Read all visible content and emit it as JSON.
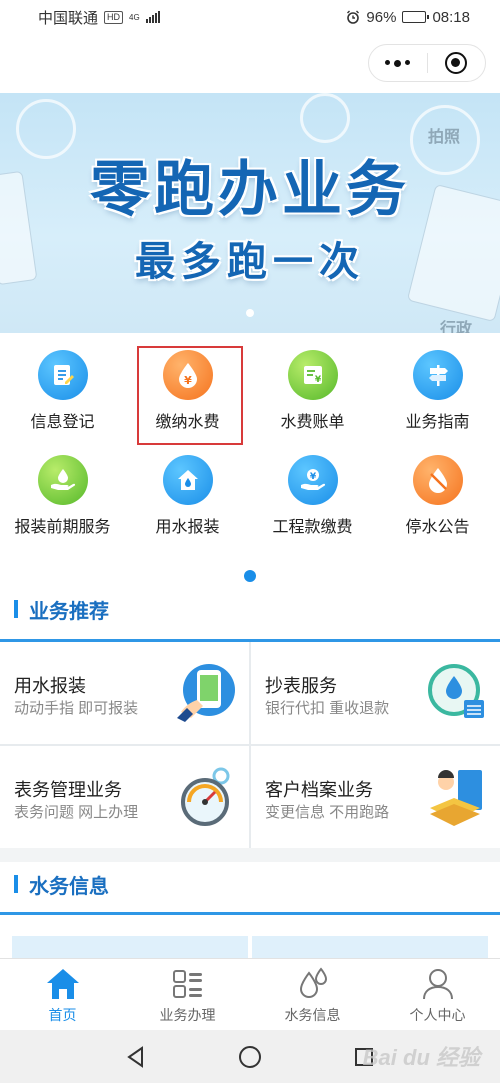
{
  "status_bar": {
    "carrier": "中国联通",
    "hd": "HD",
    "network": "4G",
    "battery_percent": "96%",
    "battery_level": 0.96,
    "time": "08:18"
  },
  "banner": {
    "line1": "零跑办业务",
    "line2": "最多跑一次",
    "bg_tag_1": "拍照",
    "bg_tag_2": "行政"
  },
  "services": [
    {
      "label": "信息登记",
      "icon": "edit-doc-icon",
      "color": "blue"
    },
    {
      "label": "缴纳水费",
      "icon": "yuan-drop-icon",
      "color": "orange",
      "highlighted": true
    },
    {
      "label": "水费账单",
      "icon": "bill-icon",
      "color": "green"
    },
    {
      "label": "业务指南",
      "icon": "signpost-icon",
      "color": "blue"
    },
    {
      "label": "报装前期服务",
      "icon": "hand-drop-icon",
      "color": "green"
    },
    {
      "label": "用水报装",
      "icon": "house-drop-icon",
      "color": "blue"
    },
    {
      "label": "工程款缴费",
      "icon": "hand-yuan-icon",
      "color": "blue"
    },
    {
      "label": "停水公告",
      "icon": "no-water-icon",
      "color": "orange"
    }
  ],
  "recommend": {
    "title": "业务推荐",
    "items": [
      {
        "name": "用水报装",
        "desc": "动动手指 即可报装",
        "icon": "phone-tap-icon"
      },
      {
        "name": "抄表服务",
        "desc": "银行代扣 重收退款",
        "icon": "clock-drop-icon"
      },
      {
        "name": "表务管理业务",
        "desc": "表务问题 网上办理",
        "icon": "gauge-icon"
      },
      {
        "name": "客户档案业务",
        "desc": "变更信息 不用跑路",
        "icon": "person-files-icon"
      }
    ]
  },
  "news": {
    "title": "水务信息"
  },
  "tabbar": [
    {
      "label": "首页",
      "icon": "home-icon",
      "active": true
    },
    {
      "label": "业务办理",
      "icon": "grid-list-icon",
      "active": false
    },
    {
      "label": "水务信息",
      "icon": "water-drops-icon",
      "active": false
    },
    {
      "label": "个人中心",
      "icon": "user-icon",
      "active": false
    }
  ],
  "watermark": "Bai du 经验",
  "colors": {
    "accent": "#1a8ee8",
    "highlight_border": "#d83a3a",
    "section_title": "#1a6fc0"
  }
}
